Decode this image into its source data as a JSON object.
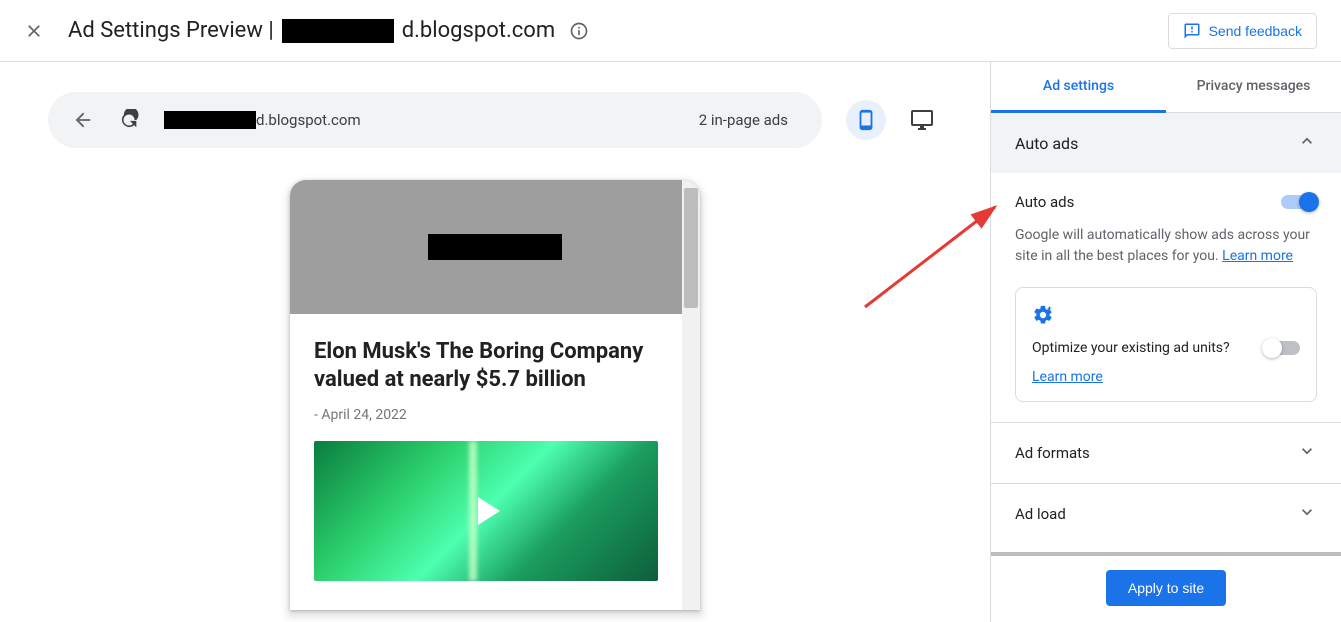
{
  "header": {
    "title_prefix": "Ad Settings Preview | ",
    "title_suffix": "d.blogspot.com",
    "feedback": "Send feedback"
  },
  "urlbar": {
    "domain_suffix": "d.blogspot.com",
    "ad_count": "2 in-page ads"
  },
  "preview": {
    "article_title": "Elon Musk's The Boring Company valued at nearly $5.7 billion",
    "article_date": "- April 24, 2022"
  },
  "sidebar": {
    "tabs": {
      "ad_settings": "Ad settings",
      "privacy": "Privacy messages"
    },
    "auto_ads_header": "Auto ads",
    "auto_ads": {
      "label": "Auto ads",
      "enabled": true,
      "description": "Google will automatically show ads across your site in all the best places for you. ",
      "learn_more": "Learn more"
    },
    "optimize": {
      "text": "Optimize your existing ad units?",
      "enabled": false,
      "learn_more": "Learn more"
    },
    "ad_formats": "Ad formats",
    "ad_load": "Ad load",
    "apply": "Apply to site"
  }
}
